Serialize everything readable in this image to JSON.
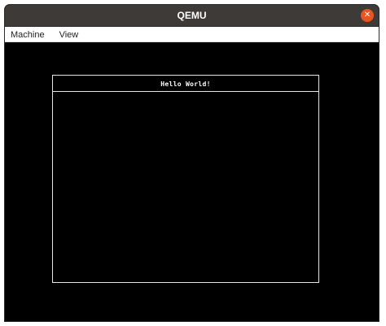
{
  "window": {
    "title": "QEMU",
    "close_icon": "close-icon"
  },
  "menubar": {
    "items": [
      {
        "label": "Machine"
      },
      {
        "label": "View"
      }
    ]
  },
  "screen": {
    "message": "Hello World!"
  },
  "colors": {
    "titlebar": "#3d3a37",
    "close": "#e95420",
    "screen_bg": "#000000",
    "text": "#ffffff"
  }
}
